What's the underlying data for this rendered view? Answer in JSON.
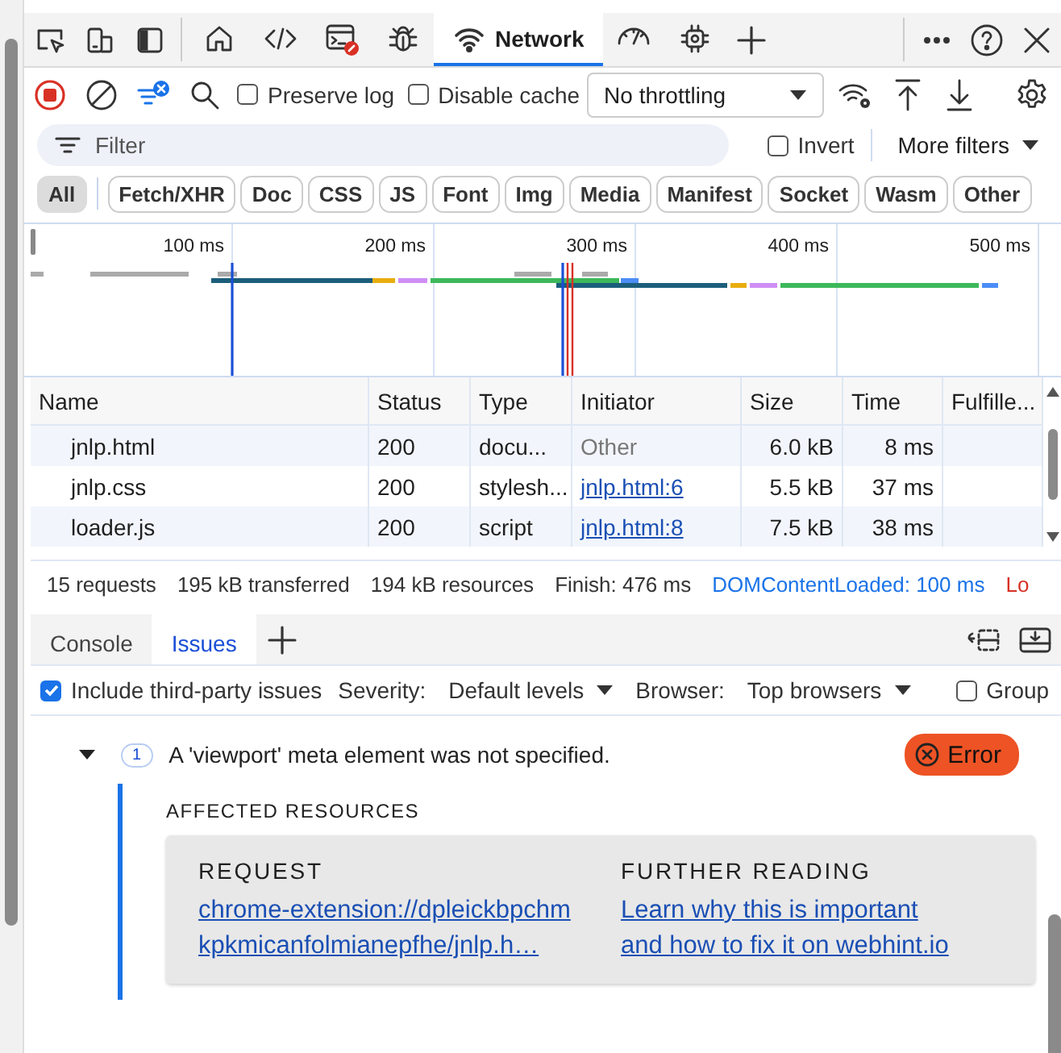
{
  "panel_tabs": [
    {
      "selected": false
    },
    {
      "selected": false
    },
    {
      "selected": false
    },
    {
      "selected": false
    },
    {
      "label": "Network",
      "selected": true
    },
    {
      "selected": false
    },
    {
      "selected": false
    }
  ],
  "network_toolbar": {
    "recording": true,
    "preserve_log": {
      "label": "Preserve log",
      "checked": false
    },
    "disable_cache": {
      "label": "Disable cache",
      "checked": false
    },
    "throttling": "No throttling"
  },
  "filter_bar": {
    "placeholder": "Filter",
    "invert": {
      "label": "Invert",
      "checked": false
    },
    "more_filters": "More filters"
  },
  "type_filters": [
    {
      "label": "All",
      "selected": true
    },
    {
      "label": "Fetch/XHR",
      "selected": false
    },
    {
      "label": "Doc",
      "selected": false
    },
    {
      "label": "CSS",
      "selected": false
    },
    {
      "label": "JS",
      "selected": false
    },
    {
      "label": "Font",
      "selected": false
    },
    {
      "label": "Img",
      "selected": false
    },
    {
      "label": "Media",
      "selected": false
    },
    {
      "label": "Manifest",
      "selected": false
    },
    {
      "label": "Socket",
      "selected": false
    },
    {
      "label": "Wasm",
      "selected": false
    },
    {
      "label": "Other",
      "selected": false
    }
  ],
  "overview": {
    "ticks": [
      "100 ms",
      "200 ms",
      "300 ms",
      "400 ms",
      "500 ms"
    ]
  },
  "table": {
    "columns": [
      "Name",
      "Status",
      "Type",
      "Initiator",
      "Size",
      "Time",
      "Fulfille..."
    ],
    "rows": [
      {
        "name": "jnlp.html",
        "status": "200",
        "type": "docu...",
        "initiator": "Other",
        "initiator_link": false,
        "size": "6.0 kB",
        "time": "8 ms"
      },
      {
        "name": "jnlp.css",
        "status": "200",
        "type": "stylesh...",
        "initiator": "jnlp.html:6",
        "initiator_link": true,
        "size": "5.5 kB",
        "time": "37 ms"
      },
      {
        "name": "loader.js",
        "status": "200",
        "type": "script",
        "initiator": "jnlp.html:8",
        "initiator_link": true,
        "size": "7.5 kB",
        "time": "38 ms"
      }
    ]
  },
  "summary": [
    {
      "text": "15 requests",
      "kind": "plain"
    },
    {
      "text": "195 kB transferred",
      "kind": "plain"
    },
    {
      "text": "194 kB resources",
      "kind": "plain"
    },
    {
      "text": "Finish: 476 ms",
      "kind": "plain"
    },
    {
      "text": "DOMContentLoaded: 100 ms",
      "kind": "dcl"
    },
    {
      "text": "Lo",
      "kind": "load"
    }
  ],
  "drawer": {
    "tabs": [
      {
        "label": "Console",
        "selected": false
      },
      {
        "label": "Issues",
        "selected": true
      }
    ],
    "third_party": {
      "label": "Include third-party issues",
      "checked": true
    },
    "severity_label": "Severity:",
    "severity": "Default levels",
    "browser_label": "Browser:",
    "browser": "Top browsers",
    "group": {
      "label": "Group",
      "checked": false
    }
  },
  "issue": {
    "expanded": true,
    "count": "1",
    "message": "A 'viewport' meta element was not specified.",
    "severity": "Error",
    "affected_heading": "AFFECTED RESOURCES",
    "request_heading": "REQUEST",
    "request_link": "chrome-extension://dpleickbpchmkpkmicanfolmianepfhe/jnlp.h…",
    "further_heading": "FURTHER READING",
    "further_link": "Learn why this is important and how to fix it on webhint.io"
  }
}
